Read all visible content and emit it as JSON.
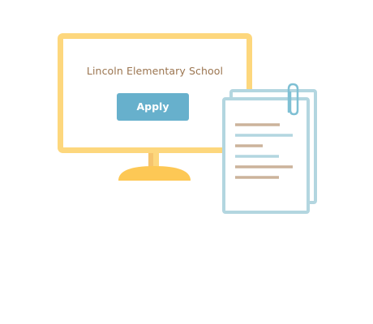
{
  "school": {
    "name": "Lincoln Elementary School"
  },
  "actions": {
    "apply_label": "Apply"
  },
  "icons": {
    "monitor": "monitor-icon",
    "documents": "document-stack-icon",
    "paperclip": "paperclip-icon"
  },
  "colors": {
    "monitor_frame": "#fdd77d",
    "monitor_stand_neck": "#f6c46d",
    "monitor_base": "#fdc855",
    "school_text": "#9b7550",
    "apply_button": "#67b0cc",
    "apply_text": "#ffffff",
    "document_outline": "#b3d6e0",
    "document_line_tan": "#ccb39b",
    "document_line_blue": "#b3d6e0"
  }
}
